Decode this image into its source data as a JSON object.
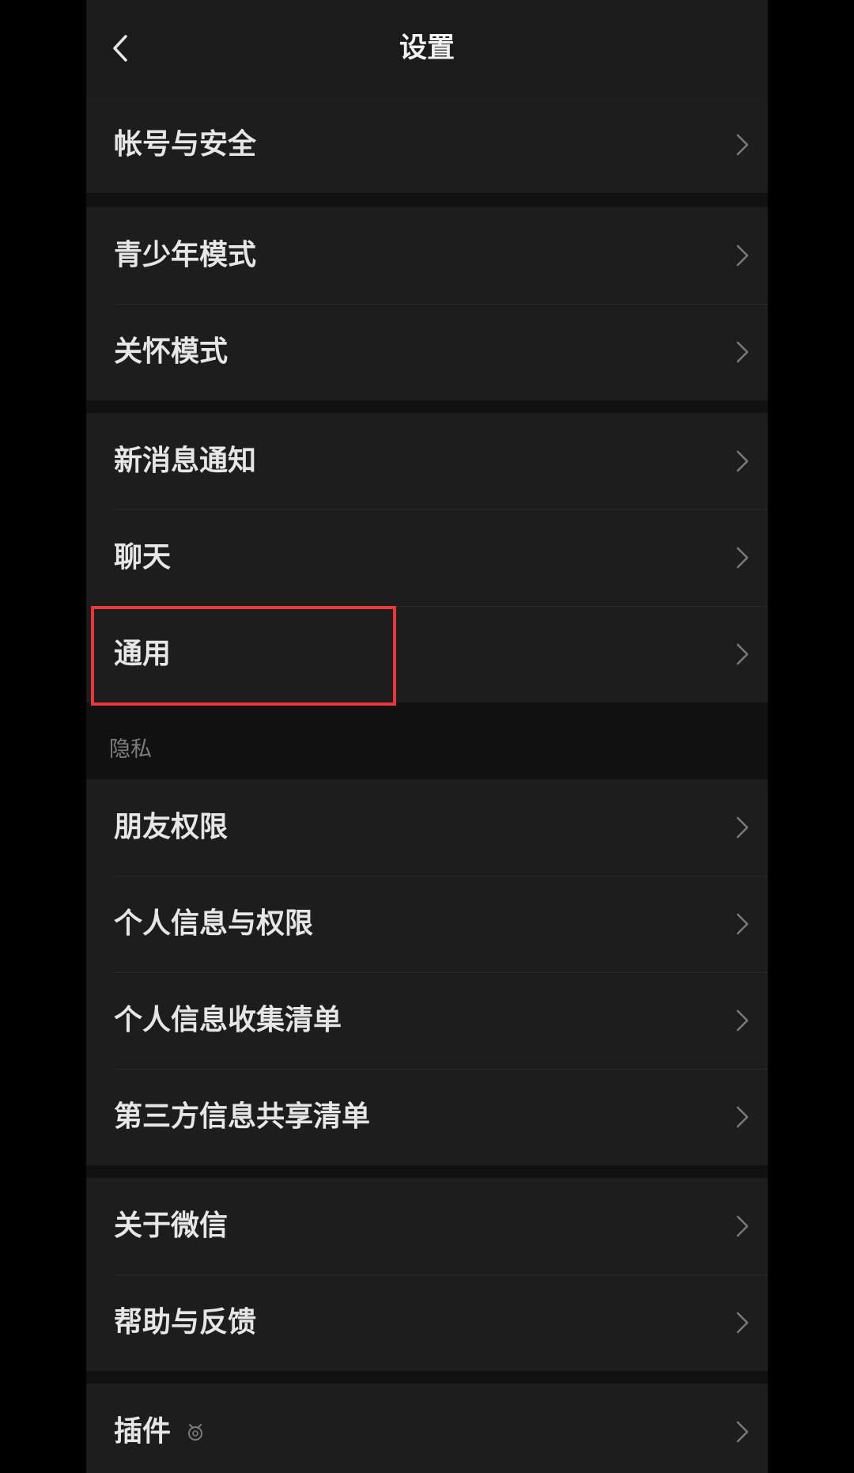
{
  "navbar": {
    "title": "设置",
    "back_icon": "chevron-left-icon"
  },
  "groups": [
    {
      "items": [
        {
          "label": "帐号与安全"
        }
      ]
    },
    {
      "items": [
        {
          "label": "青少年模式"
        },
        {
          "label": "关怀模式"
        }
      ]
    },
    {
      "items": [
        {
          "label": "新消息通知"
        },
        {
          "label": "聊天"
        },
        {
          "label": "通用",
          "highlighted": true
        }
      ]
    },
    {
      "header": "隐私",
      "items": [
        {
          "label": "朋友权限"
        },
        {
          "label": "个人信息与权限"
        },
        {
          "label": "个人信息收集清单"
        },
        {
          "label": "第三方信息共享清单"
        }
      ]
    },
    {
      "items": [
        {
          "label": "关于微信"
        },
        {
          "label": "帮助与反馈"
        }
      ]
    },
    {
      "items": [
        {
          "label": "插件",
          "icon": "plugin-icon"
        }
      ]
    }
  ],
  "colors": {
    "background": "#111111",
    "row": "#1d1d1d",
    "text": "#e6e6e6",
    "highlight": "#e8383d"
  }
}
